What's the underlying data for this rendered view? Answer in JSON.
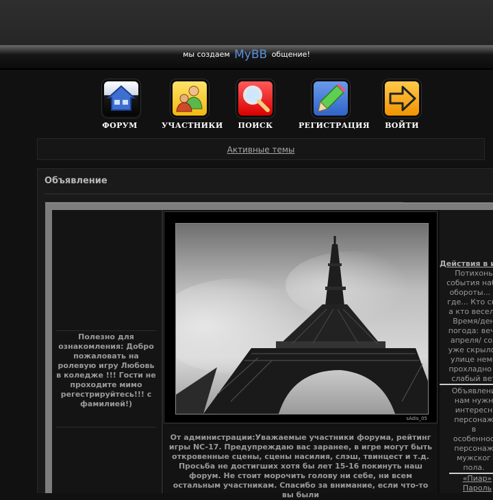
{
  "banner": {
    "prefix": "мы создаем",
    "brand": "MyBB",
    "suffix": "общение!"
  },
  "nav": [
    {
      "label": "ФОРУМ",
      "icon": "house-icon"
    },
    {
      "label": "УЧАСТНИКИ",
      "icon": "users-icon"
    },
    {
      "label": "ПОИСК",
      "icon": "magnifier-icon"
    },
    {
      "label": "РЕГИСТРАЦИЯ",
      "icon": "pencil-icon"
    },
    {
      "label": "ВОЙТИ",
      "icon": "arrow-right-icon"
    }
  ],
  "active_topics": "Активные темы",
  "announcement": {
    "title": "Объявление",
    "left_text": "Полезно для ознакомления: Добро пожаловать на ролевую игру Любовь в коледже !!! Гости не проходите мимо регестрируйтесь!!! с фамилией!)",
    "photo_signature": "sAdis_05",
    "admin_text": "От администрации:Уважаемые участники форума, рейтинг игры NC-17. Предупреждаю вас заранее, в игре могут быть откровенные сцены, сцены насилия, слэш, твинцест и т.д. Просьба не достигших хотя бы лет 15-16 покинуть наш форум. Не стоит морочить голову ни себе, ни всем остальным участникам. Спасибо за внимание, если что-то вы были",
    "right_title": "Действия в и",
    "right_lines": [
      "Потихонь",
      "события наби",
      "обороты... К",
      "где... Кто ску",
      "а кто весели",
      "Время/ден",
      "погода: вече",
      "апреля/ сол",
      "уже скрылос",
      "улице немн",
      "прохладно и",
      "слабый вет"
    ],
    "right_lines2": [
      "Объявлени",
      "нам нужн",
      "интересн",
      "персонаж",
      "в",
      "особеннос",
      "персонаж",
      "мужског",
      "пола."
    ],
    "right_links": [
      "«Пиар»",
      "Пароль"
    ]
  },
  "colors": {
    "background": "#111111",
    "brand": "#5a8fd8"
  }
}
